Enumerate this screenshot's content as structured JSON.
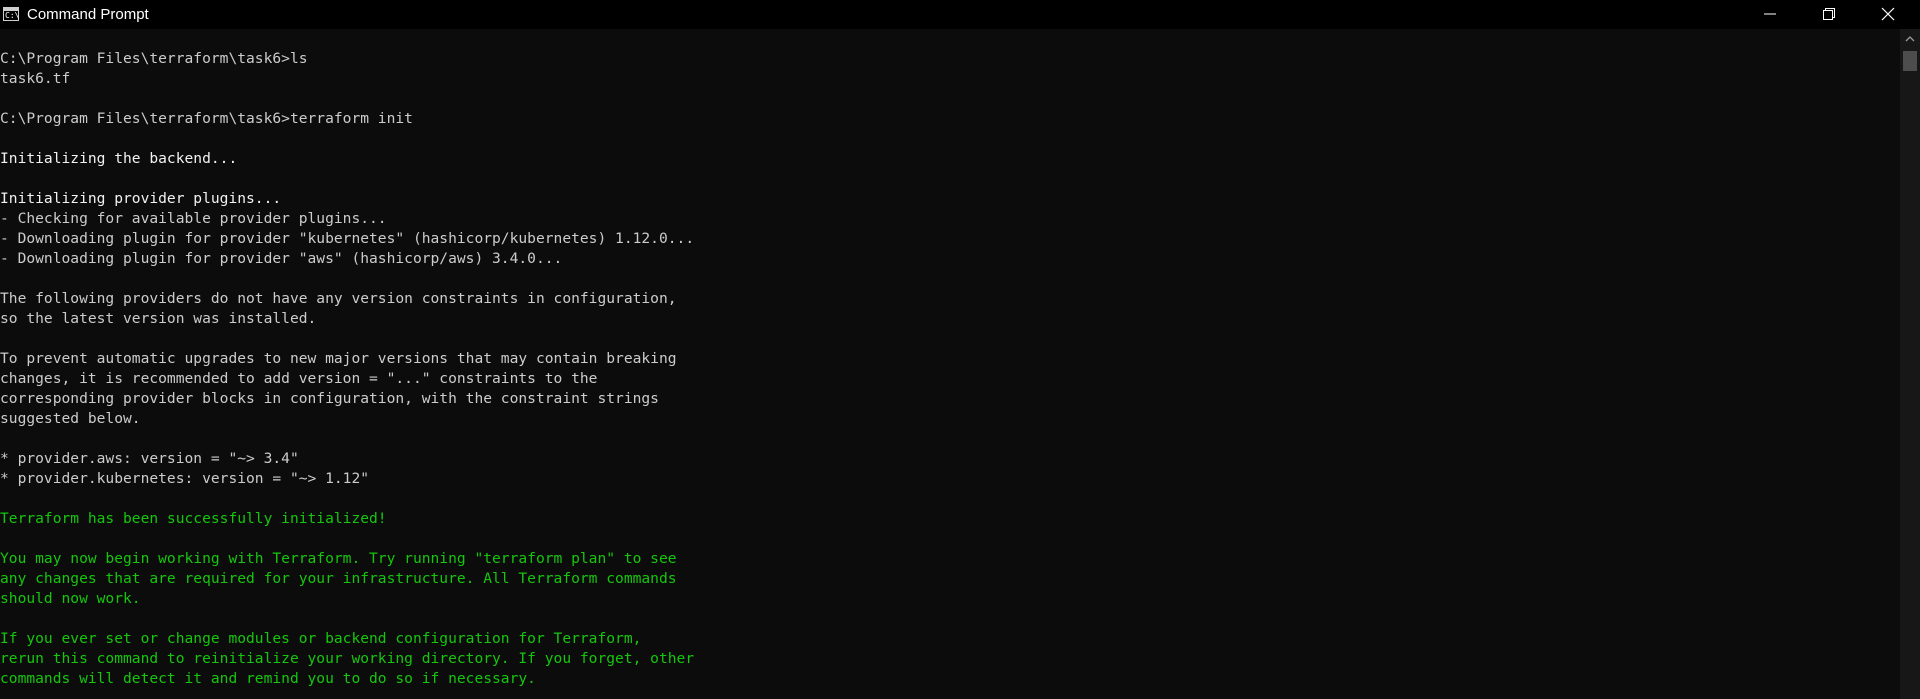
{
  "window": {
    "title": "Command Prompt",
    "icon": "cmd-icon",
    "icon_glyph": "C:\\",
    "controls": [
      "minimize-icon",
      "restore-icon",
      "close-icon"
    ]
  },
  "console": {
    "lines": [
      "",
      "C:\\Program Files\\terraform\\task6>ls",
      "task6.tf",
      "",
      "C:\\Program Files\\terraform\\task6>terraform init",
      "",
      "Initializing the backend...",
      "",
      "Initializing provider plugins...",
      "- Checking for available provider plugins...",
      "- Downloading plugin for provider \"kubernetes\" (hashicorp/kubernetes) 1.12.0...",
      "- Downloading plugin for provider \"aws\" (hashicorp/aws) 3.4.0...",
      "",
      "The following providers do not have any version constraints in configuration,",
      "so the latest version was installed.",
      "",
      "To prevent automatic upgrades to new major versions that may contain breaking",
      "changes, it is recommended to add version = \"...\" constraints to the",
      "corresponding provider blocks in configuration, with the constraint strings",
      "suggested below.",
      "",
      "* provider.aws: version = \"~> 3.4\"",
      "* provider.kubernetes: version = \"~> 1.12\"",
      "",
      "Terraform has been successfully initialized!",
      "",
      "You may now begin working with Terraform. Try running \"terraform plan\" to see",
      "any changes that are required for your infrastructure. All Terraform commands",
      "should now work.",
      "",
      "If you ever set or change modules or backend configuration for Terraform,",
      "rerun this command to reinitialize your working directory. If you forget, other",
      "commands will detect it and remind you to do so if necessary."
    ]
  },
  "colors": {
    "background": "#0c0c0c",
    "text": "#cccccc",
    "bright_text": "#f2f2f2",
    "success": "#16c60c"
  }
}
